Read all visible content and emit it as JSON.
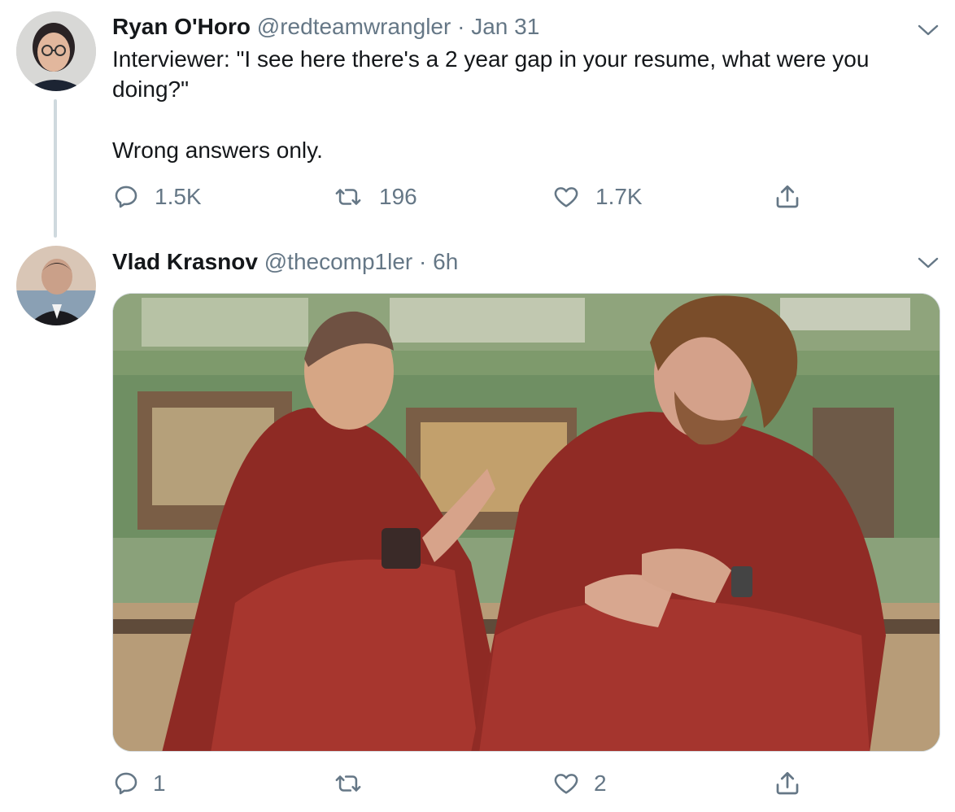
{
  "tweets": [
    {
      "author_name": "Ryan O'Horo",
      "handle": "@redteamwrangler",
      "separator": "·",
      "time": "Jan 31",
      "text_line1": "Interviewer: \"I see here there's a 2 year gap in your resume, what were you",
      "text_line2": "doing?\"",
      "text_line3": "Wrong answers only.",
      "replies": "1.5K",
      "retweets": "196",
      "likes": "1.7K",
      "avatar_icon": "avatar-person-glasses"
    },
    {
      "author_name": "Vlad Krasnov",
      "handle": "@thecomp1ler",
      "separator": "·",
      "time": "6h",
      "replies": "1",
      "retweets": "",
      "likes": "2",
      "avatar_icon": "avatar-person",
      "media": "photo-two-men-in-red-robes"
    }
  ],
  "colors": {
    "text": "#14171a",
    "secondary": "#657786",
    "thread_line": "#cfd9de"
  }
}
